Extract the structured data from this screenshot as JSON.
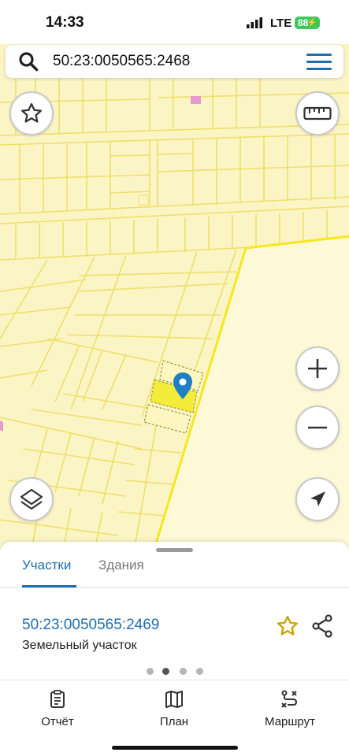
{
  "status_bar": {
    "time": "14:33",
    "network": "LTE",
    "battery": "88"
  },
  "search": {
    "value": "50:23:0050565:2468",
    "icon": "search-icon"
  },
  "map": {
    "buttons": [
      "favorite",
      "ruler",
      "zoom-in",
      "zoom-out",
      "layers",
      "locate"
    ],
    "colors": {
      "background": "#fbf5c6",
      "parcel_border": "#f0de4a",
      "boundary": "#f5e81e",
      "selected_parcel": "#f3ec3a",
      "marker": "#1f7fc3"
    }
  },
  "sheet": {
    "tabs": [
      {
        "label": "Участки",
        "active": true
      },
      {
        "label": "Здания",
        "active": false
      }
    ],
    "result": {
      "number": "50:23:0050565:2469",
      "type": "Земельный участок"
    },
    "pager": {
      "count": 4,
      "active_index": 1
    }
  },
  "bottom_nav": {
    "items": [
      {
        "label": "Отчёт",
        "icon": "report-icon"
      },
      {
        "label": "План",
        "icon": "map-plan-icon"
      },
      {
        "label": "Маршрут",
        "icon": "route-icon"
      }
    ]
  },
  "accent_color": "#1f6fb0"
}
